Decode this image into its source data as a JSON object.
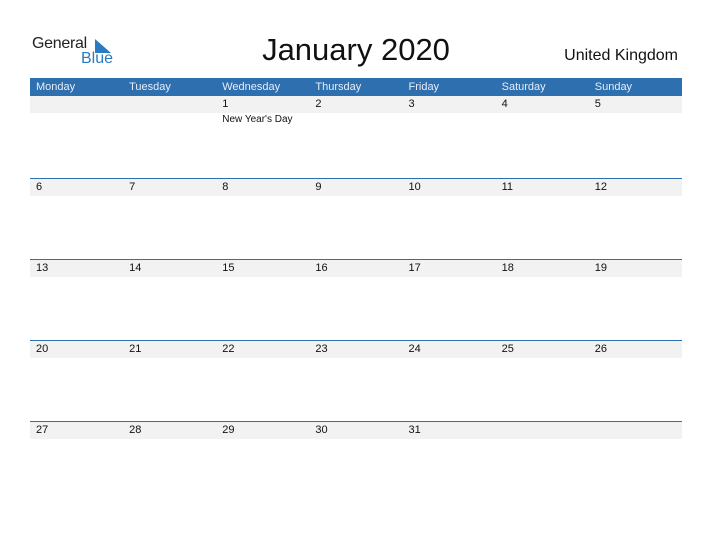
{
  "logo": {
    "line1": "General",
    "line2": "Blue"
  },
  "title": "January 2020",
  "country": "United Kingdom",
  "colors": {
    "accent": "#2e6fb0",
    "band": "#f2f2f2",
    "logo_blue": "#2a7bc4"
  },
  "weekdays": [
    "Monday",
    "Tuesday",
    "Wednesday",
    "Thursday",
    "Friday",
    "Saturday",
    "Sunday"
  ],
  "weeks": [
    {
      "days": [
        {
          "num": "",
          "holiday": ""
        },
        {
          "num": "",
          "holiday": ""
        },
        {
          "num": "1",
          "holiday": "New Year's Day"
        },
        {
          "num": "2",
          "holiday": ""
        },
        {
          "num": "3",
          "holiday": ""
        },
        {
          "num": "4",
          "holiday": ""
        },
        {
          "num": "5",
          "holiday": ""
        }
      ]
    },
    {
      "days": [
        {
          "num": "6",
          "holiday": ""
        },
        {
          "num": "7",
          "holiday": ""
        },
        {
          "num": "8",
          "holiday": ""
        },
        {
          "num": "9",
          "holiday": ""
        },
        {
          "num": "10",
          "holiday": ""
        },
        {
          "num": "11",
          "holiday": ""
        },
        {
          "num": "12",
          "holiday": ""
        }
      ]
    },
    {
      "days": [
        {
          "num": "13",
          "holiday": ""
        },
        {
          "num": "14",
          "holiday": ""
        },
        {
          "num": "15",
          "holiday": ""
        },
        {
          "num": "16",
          "holiday": ""
        },
        {
          "num": "17",
          "holiday": ""
        },
        {
          "num": "18",
          "holiday": ""
        },
        {
          "num": "19",
          "holiday": ""
        }
      ]
    },
    {
      "days": [
        {
          "num": "20",
          "holiday": ""
        },
        {
          "num": "21",
          "holiday": ""
        },
        {
          "num": "22",
          "holiday": ""
        },
        {
          "num": "23",
          "holiday": ""
        },
        {
          "num": "24",
          "holiday": ""
        },
        {
          "num": "25",
          "holiday": ""
        },
        {
          "num": "26",
          "holiday": ""
        }
      ]
    },
    {
      "days": [
        {
          "num": "27",
          "holiday": ""
        },
        {
          "num": "28",
          "holiday": ""
        },
        {
          "num": "29",
          "holiday": ""
        },
        {
          "num": "30",
          "holiday": ""
        },
        {
          "num": "31",
          "holiday": ""
        },
        {
          "num": "",
          "holiday": ""
        },
        {
          "num": "",
          "holiday": ""
        }
      ]
    }
  ]
}
